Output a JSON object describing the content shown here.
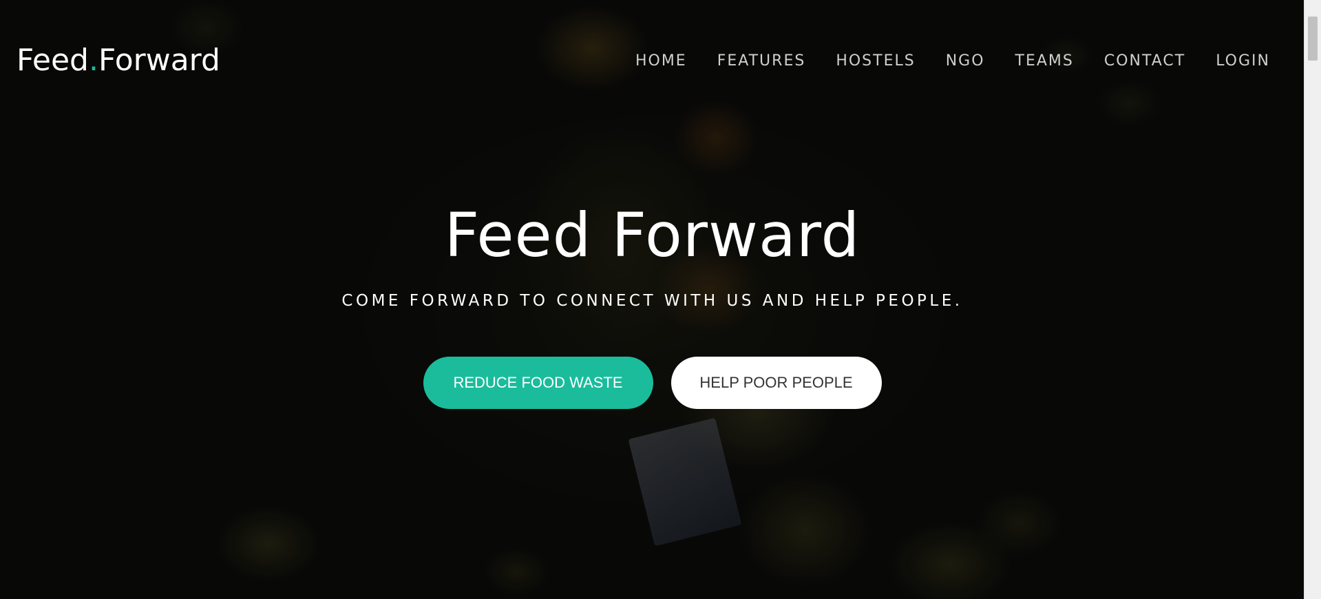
{
  "brand": {
    "name_part1": "Feed",
    "dot": ".",
    "name_part2": "Forward"
  },
  "nav": {
    "items": [
      {
        "label": "HOME"
      },
      {
        "label": "FEATURES"
      },
      {
        "label": "HOSTELS"
      },
      {
        "label": "NGO"
      },
      {
        "label": "TEAMS"
      },
      {
        "label": "CONTACT"
      },
      {
        "label": "LOGIN"
      }
    ]
  },
  "hero": {
    "title": "Feed Forward",
    "subtitle": "COME FORWARD TO CONNECT WITH US AND HELP PEOPLE.",
    "primary_button": "REDUCE FOOD WASTE",
    "secondary_button": "HELP POOR PEOPLE"
  },
  "colors": {
    "accent": "#1abc9c",
    "text_light": "#ffffff",
    "nav_text": "#cfcfcf",
    "overlay": "#000000"
  }
}
